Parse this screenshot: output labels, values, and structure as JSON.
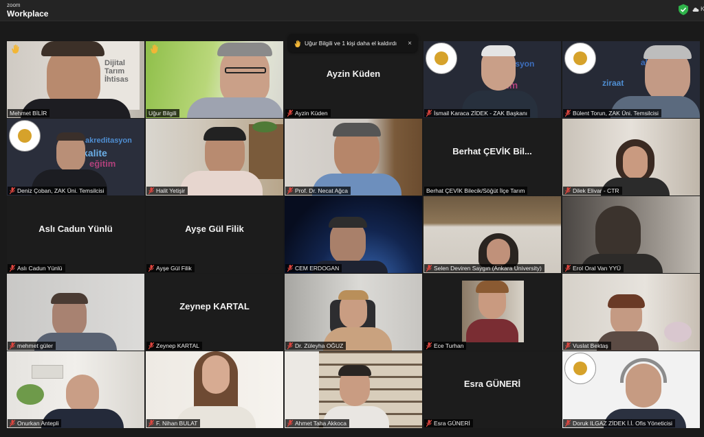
{
  "app": {
    "brand_small": "zoom",
    "brand_big": "Workplace",
    "top_right_letter": "K"
  },
  "raise_banner": {
    "text": "Uğur Bilgili ve 1 kişi daha el kaldırdı",
    "close": "×"
  },
  "icons": {
    "hand": "raised-hand-icon",
    "mic": "muted-microphone-icon",
    "shield": "security-shield-icon"
  },
  "colors": {
    "active_border": "#3fbf52",
    "muted_mic": "#e0463f",
    "hand": "#f2b636"
  },
  "decor": {
    "book_lines": [
      "Dijital",
      "Tarım",
      "İhtisas"
    ],
    "wordcloud_a": [
      "akreditasyon",
      "kalite",
      "eğitim"
    ],
    "wordcloud_b": [
      "ditasyon",
      "eğitim"
    ],
    "wordcloud_c": [
      "ziraat",
      "ak"
    ]
  },
  "tiles": [
    {
      "name": "Mehmet BİLİR",
      "center": ""
    },
    {
      "name": "Uğur Bilgili",
      "center": ""
    },
    {
      "name": "Ayzin Küden",
      "center": "Ayzin Küden"
    },
    {
      "name": "İsmail Karaca ZİDEK - ZAK Başkanı",
      "center": ""
    },
    {
      "name": "Bülent Torun, ZAK Üni. Temsilcisi",
      "center": ""
    },
    {
      "name": "Deniz Çoban, ZAK Üni. Temsilcisi",
      "center": ""
    },
    {
      "name": "Halit Yetişir",
      "center": ""
    },
    {
      "name": "Prof. Dr. Necat Ağca",
      "center": ""
    },
    {
      "name": "Berhat ÇEVİK Bilecik/Söğüt İlçe Tarım",
      "center": "Berhat ÇEVİK Bil..."
    },
    {
      "name": "Dilek Elivar - CTR",
      "center": ""
    },
    {
      "name": "Aslı Cadun Yünlü",
      "center": "Aslı Cadun Yünlü"
    },
    {
      "name": "Ayşe Gül Filik",
      "center": "Ayşe Gül Filik"
    },
    {
      "name": "CEM ERDOGAN",
      "center": ""
    },
    {
      "name": "Selen Deviren Saygın (Ankara University)",
      "center": ""
    },
    {
      "name": "Erol Oral Van YYÜ",
      "center": ""
    },
    {
      "name": "mehmet güler",
      "center": ""
    },
    {
      "name": "Zeynep KARTAL",
      "center": "Zeynep KARTAL"
    },
    {
      "name": "Dr. Züleyha OĞUZ",
      "center": ""
    },
    {
      "name": "Ece Turhan",
      "center": ""
    },
    {
      "name": "Vuslat Bektaş",
      "center": ""
    },
    {
      "name": "Onurkan Antepli",
      "center": ""
    },
    {
      "name": "F. Nihan BULAT",
      "center": ""
    },
    {
      "name": "Ahmet Taha Akkoca",
      "center": ""
    },
    {
      "name": "Esra GÜNERİ",
      "center": "Esra GÜNERİ"
    },
    {
      "name": "Doruk ILGAZ ZİDEK İ.İ. Ofis Yöneticisi",
      "center": ""
    }
  ]
}
